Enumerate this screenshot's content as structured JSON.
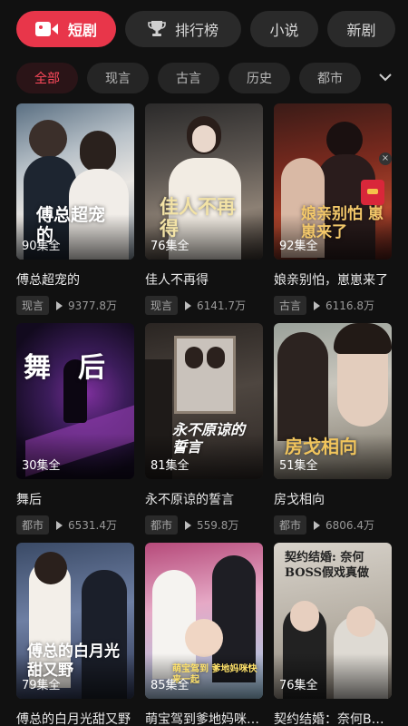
{
  "top_tabs": [
    {
      "label": "短剧",
      "icon": "video-icon",
      "active": true
    },
    {
      "label": "排行榜",
      "icon": "trophy-icon",
      "active": false
    },
    {
      "label": "小说",
      "active": false
    },
    {
      "label": "新剧",
      "active": false
    }
  ],
  "categories": [
    {
      "label": "全部",
      "active": true
    },
    {
      "label": "现言",
      "active": false
    },
    {
      "label": "古言",
      "active": false
    },
    {
      "label": "历史",
      "active": false
    },
    {
      "label": "都市",
      "active": false
    }
  ],
  "dramas": [
    {
      "title": "傅总超宠的",
      "episodes": "90集全",
      "tag": "现言",
      "views": "9377.8万",
      "poster_text": "傅总超宠的"
    },
    {
      "title": "佳人不再得",
      "episodes": "76集全",
      "tag": "现言",
      "views": "6141.7万",
      "poster_text": "佳人不再得"
    },
    {
      "title": "娘亲别怕，崽崽来了",
      "episodes": "92集全",
      "tag": "古言",
      "views": "6116.8万",
      "poster_text": "娘亲别怕 崽崽来了"
    },
    {
      "title": "舞后",
      "episodes": "30集全",
      "tag": "都市",
      "views": "6531.4万",
      "poster_text": "舞后"
    },
    {
      "title": "永不原谅的誓言",
      "episodes": "81集全",
      "tag": "都市",
      "views": "559.8万",
      "poster_text": "永不原谅的誓言"
    },
    {
      "title": "房戈相向",
      "episodes": "51集全",
      "tag": "都市",
      "views": "6806.4万",
      "poster_text": "房戈相向"
    },
    {
      "title": "傅总的白月光甜又野",
      "episodes": "79集全",
      "poster_text": "傅总的白月光 甜又野"
    },
    {
      "title": "萌宝驾到爹地妈咪…",
      "episodes": "85集全",
      "poster_text": "萌宝驾到 爹地妈咪快来一起"
    },
    {
      "title": "契约结婚：奈何B…",
      "episodes": "76集全",
      "poster_text": "契约结婚: 奈何BOSS假戏真做"
    }
  ],
  "colors": {
    "accent": "#e8364a",
    "background": "#111111"
  }
}
